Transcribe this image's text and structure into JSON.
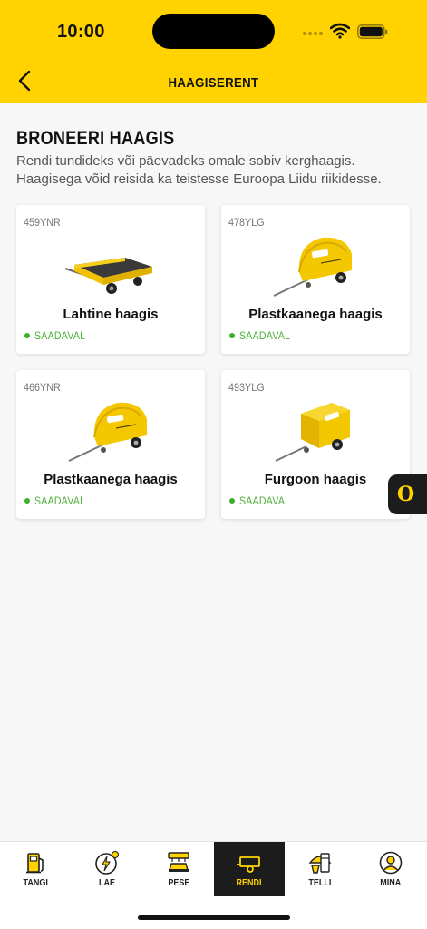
{
  "status_bar": {
    "time": "10:00"
  },
  "header": {
    "title": "HAAGISERENT"
  },
  "page": {
    "title": "BRONEERI HAAGIS",
    "intro_line1": "Rendi tundideks või päevadeks omale sobiv kerghaagis.",
    "intro_line2": "Haagisega võid reisida ka teistesse Euroopa Liidu riikidesse."
  },
  "trailers": [
    {
      "plate": "459YNR",
      "name": "Lahtine haagis",
      "status": "SAADAVAL",
      "image": "open-trailer-image"
    },
    {
      "plate": "478YLG",
      "name": "Plastkaanega haagis",
      "status": "SAADAVAL",
      "image": "covered-trailer-image"
    },
    {
      "plate": "466YNR",
      "name": "Plastkaanega haagis",
      "status": "SAADAVAL",
      "image": "covered-trailer-image"
    },
    {
      "plate": "493YLG",
      "name": "Furgoon haagis",
      "status": "SAADAVAL",
      "image": "box-trailer-image"
    }
  ],
  "fab": {
    "logo": "O"
  },
  "tabs": [
    {
      "label": "TANGI",
      "icon": "fuel-pump-icon"
    },
    {
      "label": "LAE",
      "icon": "ev-charge-icon"
    },
    {
      "label": "PESE",
      "icon": "car-wash-icon"
    },
    {
      "label": "RENDI",
      "icon": "trailer-icon",
      "active": true
    },
    {
      "label": "TELLI",
      "icon": "food-order-icon"
    },
    {
      "label": "MINA",
      "icon": "profile-icon"
    }
  ],
  "colors": {
    "brand_yellow": "#ffd200",
    "available_green": "#3fae2a",
    "dark": "#1c1c1c"
  }
}
